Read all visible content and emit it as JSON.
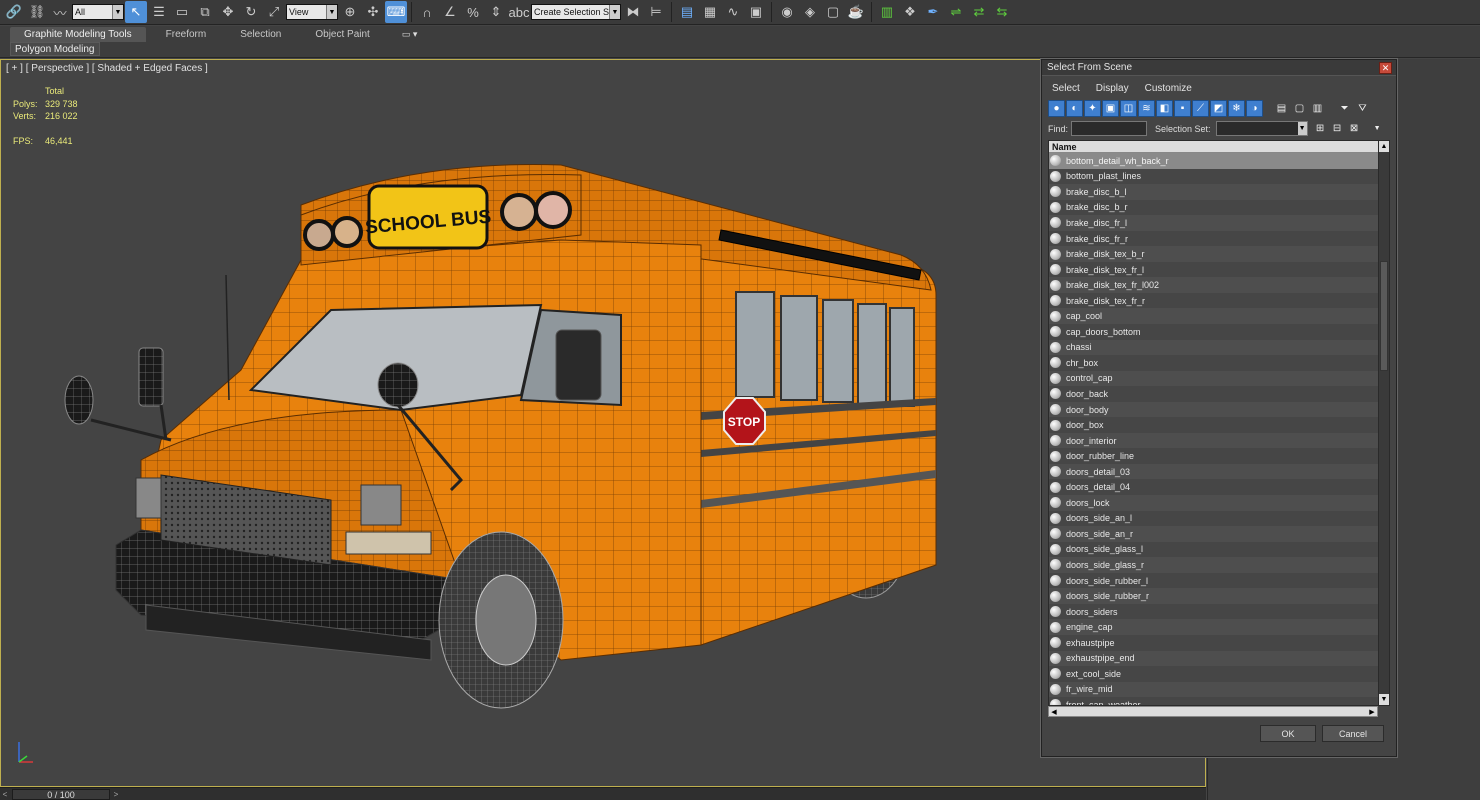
{
  "toolbar": {
    "filter_value": "All",
    "refcoord_value": "View",
    "selection_set_placeholder": "Create Selection Se"
  },
  "ribbon": {
    "tabs": [
      "Graphite Modeling Tools",
      "Freeform",
      "Selection",
      "Object Paint"
    ],
    "active_tab": "Graphite Modeling Tools",
    "panel": "Polygon Modeling"
  },
  "viewport": {
    "label": "[ + ] [ Perspective ] [ Shaded + Edged Faces ]",
    "stats": {
      "total_label": "Total",
      "polys_label": "Polys:",
      "polys_value": "329 738",
      "verts_label": "Verts:",
      "verts_value": "216 022",
      "fps_label": "FPS:",
      "fps_value": "46,441"
    },
    "sign_text": "SCHOOL BUS",
    "stop_text": "STOP"
  },
  "timeslider": {
    "value": "0 / 100"
  },
  "dialog": {
    "title": "Select From Scene",
    "menu": [
      "Select",
      "Display",
      "Customize"
    ],
    "find_label": "Find:",
    "selection_set_label": "Selection Set:",
    "column_header": "Name",
    "items": [
      "bottom_detail_wh_back_r",
      "bottom_plast_lines",
      "brake_disc_b_l",
      "brake_disc_b_r",
      "brake_disc_fr_l",
      "brake_disc_fr_r",
      "brake_disk_tex_b_r",
      "brake_disk_tex_fr_l",
      "brake_disk_tex_fr_l002",
      "brake_disk_tex_fr_r",
      "cap_cool",
      "cap_doors_bottom",
      "chassi",
      "chr_box",
      "control_cap",
      "door_back",
      "door_body",
      "door_box",
      "door_interior",
      "door_rubber_line",
      "doors_detail_03",
      "doors_detail_04",
      "doors_lock",
      "doors_side_an_l",
      "doors_side_an_r",
      "doors_side_glass_l",
      "doors_side_glass_r",
      "doors_side_rubber_l",
      "doors_side_rubber_r",
      "doors_siders",
      "engine_cap",
      "exhaustpipe",
      "exhaustpipe_end",
      "ext_cool_side",
      "fr_wire_mid",
      "front_cap_weather"
    ],
    "ok_label": "OK",
    "cancel_label": "Cancel"
  }
}
